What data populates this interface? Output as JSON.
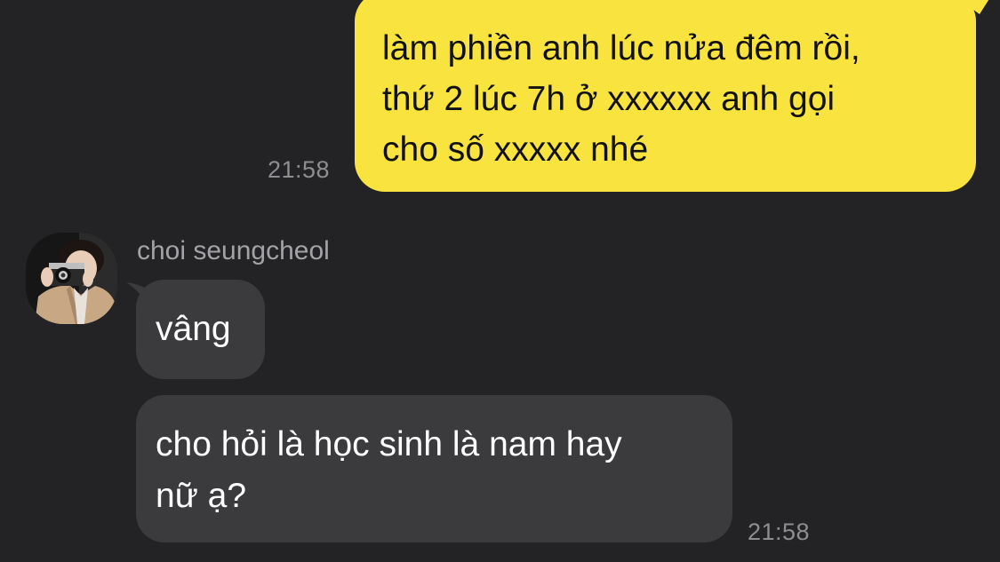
{
  "conversation": {
    "outgoing": {
      "lines": [
        "làm phiền anh lúc nửa đêm rồi,",
        "thứ 2 lúc 7h ở xxxxxx anh gọi",
        "cho số xxxxx nhé"
      ],
      "time": "21:58"
    },
    "incoming": {
      "sender": "choi seungcheol",
      "messages": [
        {
          "lines": [
            "vâng"
          ]
        },
        {
          "lines": [
            "cho hỏi là học sinh là nam hay",
            "nữ ạ?"
          ]
        }
      ],
      "time": "21:58"
    }
  },
  "colors": {
    "background": "#232325",
    "outgoing_bubble": "#f8e33f",
    "incoming_bubble": "#3b3b3d",
    "timestamp": "#8e8e92"
  }
}
